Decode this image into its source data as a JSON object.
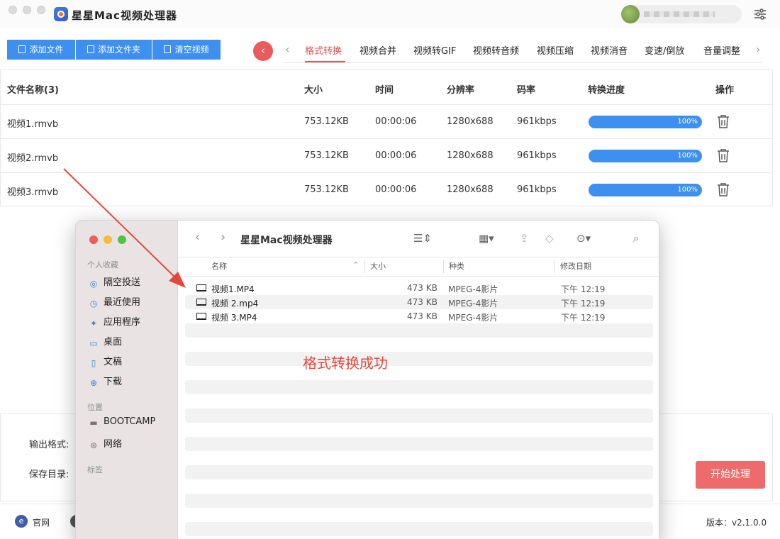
{
  "app": {
    "title": "星星Mac视频处理器"
  },
  "toolbar": {
    "add_file": "添加文件",
    "add_folder": "添加文件夹",
    "clear_videos": "清空视频",
    "prev_symbol": "‹"
  },
  "tabs": {
    "left_arrow": "‹",
    "right_arrow": "›",
    "items": [
      {
        "label": "格式转换",
        "active": true
      },
      {
        "label": "视频合并"
      },
      {
        "label": "视频转GIF"
      },
      {
        "label": "视频转音频"
      },
      {
        "label": "视频压缩"
      },
      {
        "label": "视频消音"
      },
      {
        "label": "变速/倒放"
      },
      {
        "label": "音量调整"
      }
    ]
  },
  "table": {
    "headers": {
      "name": "文件名称(3)",
      "size": "大小",
      "duration": "时间",
      "resolution": "分辨率",
      "bitrate": "码率",
      "progress": "转换进度",
      "action": "操作"
    },
    "rows": [
      {
        "name": "视频1.rmvb",
        "size": "753.12KB",
        "duration": "00:00:06",
        "resolution": "1280x688",
        "bitrate": "961kbps",
        "progress": "100%",
        "progress_value": 100
      },
      {
        "name": "视频2.rmvb",
        "size": "753.12KB",
        "duration": "00:00:06",
        "resolution": "1280x688",
        "bitrate": "961kbps",
        "progress": "100%",
        "progress_value": 100
      },
      {
        "name": "视频3.rmvb",
        "size": "753.12KB",
        "duration": "00:00:06",
        "resolution": "1280x688",
        "bitrate": "961kbps",
        "progress": "100%",
        "progress_value": 100
      }
    ]
  },
  "settings": {
    "output_format_label": "输出格式:",
    "save_dir_label": "保存目录:",
    "start_button": "开始处理"
  },
  "footer": {
    "website_label": "官网",
    "website_icon_letter": "e",
    "version": "版本：v2.1.0.0"
  },
  "finder": {
    "title": "星星Mac视频处理器",
    "sidebar": {
      "favorites_header": "个人收藏",
      "favorites": [
        {
          "label": "隔空投送",
          "icon": "airdrop-icon"
        },
        {
          "label": "最近使用",
          "icon": "clock-icon"
        },
        {
          "label": "应用程序",
          "icon": "apps-icon"
        },
        {
          "label": "桌面",
          "icon": "desktop-icon"
        },
        {
          "label": "文稿",
          "icon": "document-icon"
        },
        {
          "label": "下载",
          "icon": "download-icon"
        }
      ],
      "locations_header": "位置",
      "locations": [
        {
          "label": "BOOTCAMP",
          "icon": "drive-icon"
        },
        {
          "label": "网络",
          "icon": "network-icon"
        }
      ],
      "tags_header": "标签"
    },
    "columns": {
      "name": "名称",
      "size": "大小",
      "kind": "种类",
      "modified": "修改日期"
    },
    "files": [
      {
        "name": "视频1.MP4",
        "size": "473 KB",
        "kind": "MPEG-4影片",
        "modified": "下午 12:19"
      },
      {
        "name": "视频 2.mp4",
        "size": "473 KB",
        "kind": "MPEG-4影片",
        "modified": "下午 12:19"
      },
      {
        "name": "视频 3.MP4",
        "size": "473 KB",
        "kind": "MPEG-4影片",
        "modified": "下午 12:19"
      }
    ]
  },
  "annotation": {
    "text": "格式转换成功",
    "color": "#e4473b"
  },
  "colors": {
    "accent_blue": "#3d8ff0",
    "accent_red": "#e45454",
    "start_button": "#ef6a6a"
  }
}
